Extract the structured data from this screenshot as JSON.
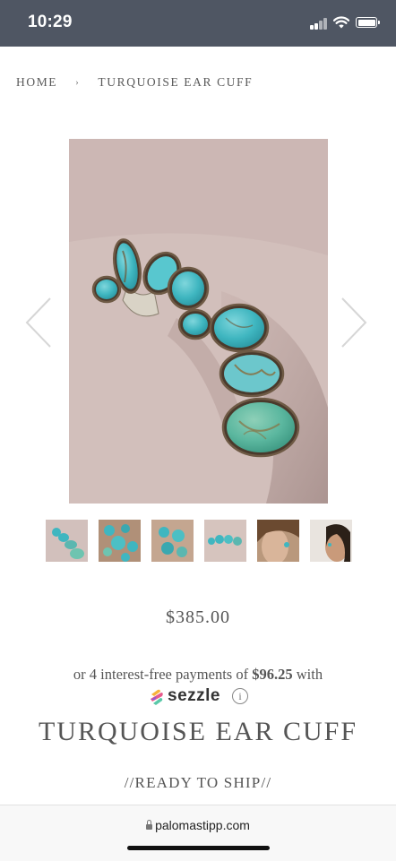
{
  "status_bar": {
    "time": "10:29"
  },
  "breadcrumb": {
    "home": "HOME",
    "separator": "›",
    "current": "TURQUOISE EAR CUFF"
  },
  "gallery": {
    "main_image": "turquoise-ear-cuff-photo",
    "thumbnail_count": 6,
    "prev_icon": "chevron-left-icon",
    "next_icon": "chevron-right-icon"
  },
  "product": {
    "price": "$385.00",
    "installments_prefix": "or 4 interest-free payments of ",
    "installments_amount": "$96.25",
    "installments_suffix": " with",
    "sezzle_label": "sezzle",
    "info_glyph": "i",
    "title": "TURQUOISE EAR CUFF",
    "ready": "//READY TO SHIP//"
  },
  "browser": {
    "url": "palomastipp.com"
  },
  "colors": {
    "status_bar": "#4f5663",
    "text": "#555555",
    "turquoise": "#3fb6c0"
  }
}
